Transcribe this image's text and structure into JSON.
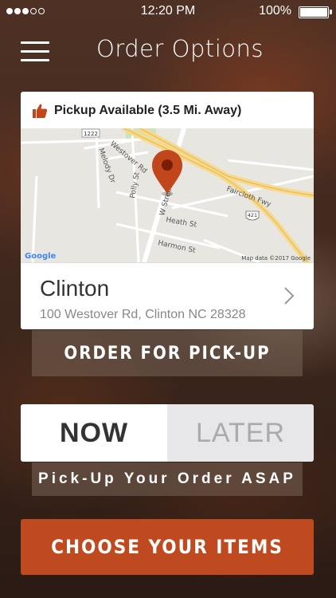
{
  "status_bar": {
    "time": "12:20 PM",
    "battery_percent": "100%",
    "signal_bars_full": 3,
    "signal_bars_total": 5
  },
  "header": {
    "title": "Order Options",
    "menu_icon": "hamburger-menu-icon"
  },
  "location_card": {
    "pickup_text": "Pickup Available (3.5 Mi. Away)",
    "pickup_icon": "thumbs-up-icon",
    "map": {
      "labels": {
        "westover": "Westover Rd",
        "melody": "Melody Dr",
        "polly": "Polly St",
        "wstreet": "W Street",
        "faircloth": "Faircloth Fwy",
        "heath": "Heath St",
        "harmon": "Harmon St",
        "shield_1222": "1222",
        "shield_421": "421"
      },
      "google_logo": "Google",
      "attribution": "Map data ©2017 Google",
      "pin_color": "#c1461b"
    },
    "store_name": "Clinton",
    "store_address": "100 Westover Rd, Clinton NC 28328",
    "chevron_icon": "chevron-right-icon"
  },
  "pickup_button": "ORDER FOR PICK-UP",
  "time_toggle": {
    "now_label": "NOW",
    "later_label": "LATER",
    "selected": "NOW"
  },
  "asap_text": "Pick-Up Your Order ASAP",
  "choose_button": "CHOOSE YOUR ITEMS",
  "colors": {
    "accent": "#c04a20",
    "thumb_icon": "#c1461b"
  }
}
